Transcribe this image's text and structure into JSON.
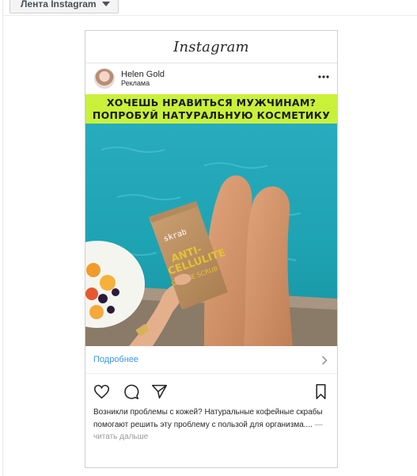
{
  "dropdown": {
    "label": "Лента Instagram",
    "icon": "caret-down-icon"
  },
  "header": {
    "logo_text": "Instagram"
  },
  "post": {
    "account_name": "Helen Gold",
    "sponsored_label": "Реклама",
    "image": {
      "banner_line1": "ХОЧЕШЬ НРАВИТЬСЯ МУЖЧИНАМ?",
      "banner_line2": "ПОПРОБУЙ НАТУРАЛЬНУЮ КОСМЕТИКУ",
      "package_brand": "skrab",
      "package_text_line1": "ANTI-",
      "package_text_line2": "CELLULITE",
      "package_text_line3": "COFFEE SCRUB"
    },
    "cta_label": "Подробнее",
    "caption_text": "Возникли проблемы с кожей? Натуральные кофейные скрабы помогают решить эту проблему с пользой для организма.... ",
    "more_link": "— читать дальше"
  },
  "colors": {
    "banner": "#c9f13a",
    "link": "#3897f0",
    "water": "#28b0bd"
  }
}
